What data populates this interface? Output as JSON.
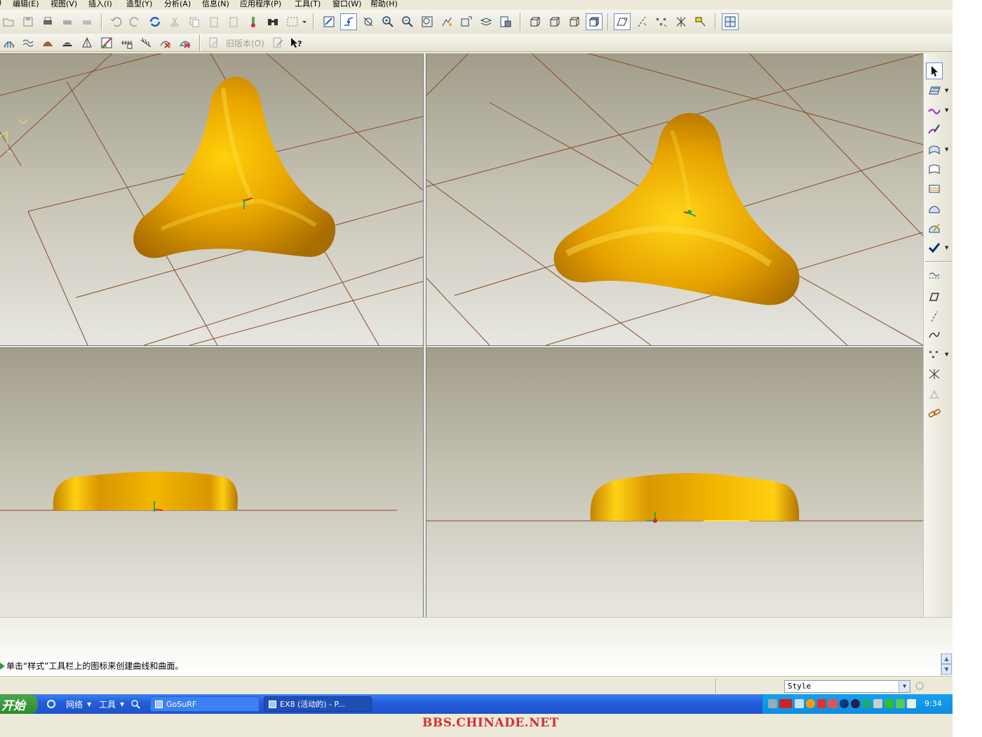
{
  "menubar": {
    "items": [
      {
        "label": "编辑(E)"
      },
      {
        "label": "视图(V)"
      },
      {
        "label": "插入(I)"
      },
      {
        "label": "造型(Y)"
      },
      {
        "label": "分析(A)"
      },
      {
        "label": "信息(N)"
      },
      {
        "label": "应用程序(P)"
      },
      {
        "label": "工具(T)"
      },
      {
        "label": "窗口(W)"
      },
      {
        "label": "帮助(H)"
      }
    ]
  },
  "toolbar2": {
    "old_version_label": "旧版本(O)"
  },
  "message": {
    "text": "单击“样式”工具栏上的图标来创建曲线和曲面。"
  },
  "status": {
    "filter_value": "Style"
  },
  "taskbar": {
    "start_label": "开始",
    "quick_items": [
      {
        "label": "网络"
      },
      {
        "label": "工具"
      }
    ],
    "tasks": [
      {
        "label": "GoSuRF"
      },
      {
        "label": "EX8 (活动的) - P..."
      }
    ],
    "clock": "9:34"
  },
  "watermark": "BBS.CHINADE.NET",
  "colors": {
    "model": "#e0a000",
    "grid": "#8a4a28",
    "taskbar": "#245edb",
    "tray": "#0d8de0"
  }
}
